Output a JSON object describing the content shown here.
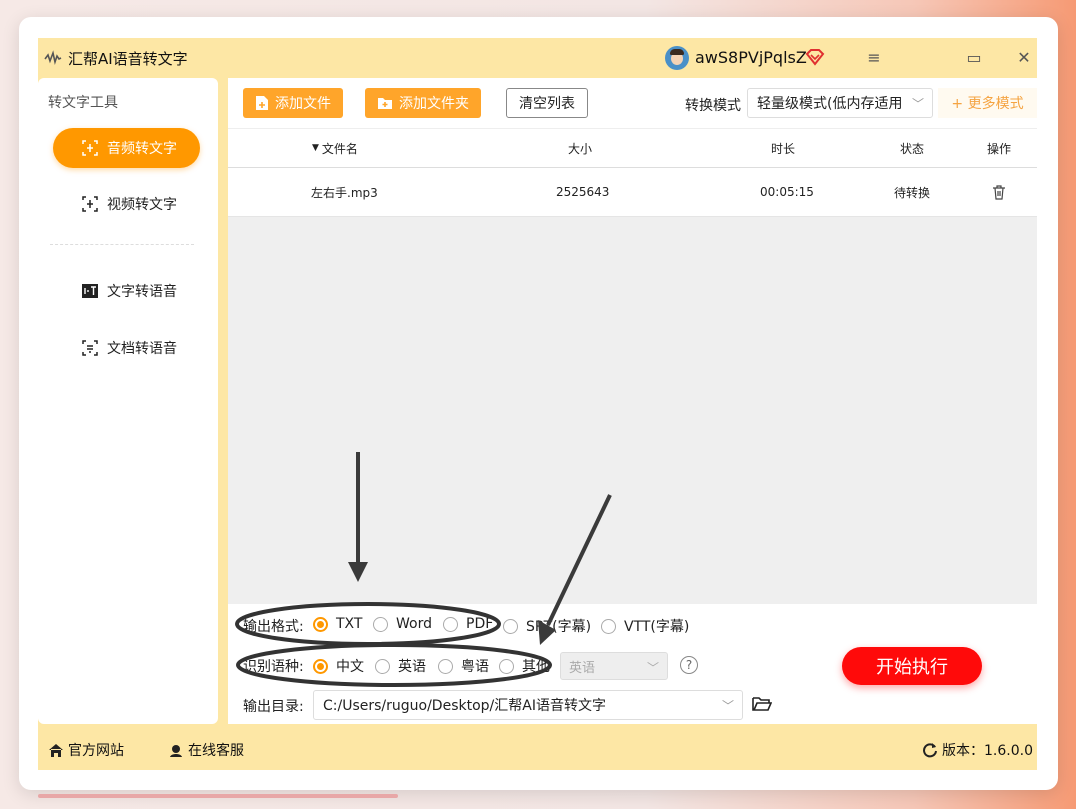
{
  "app": {
    "title": "汇帮AI语音转文字",
    "username": "awS8PVjPqlsZ"
  },
  "window_controls": {
    "menu": "≡",
    "maximize": "▭",
    "close": "✕"
  },
  "sidebar": {
    "title": "转文字工具",
    "items": [
      {
        "label": "音频转文字",
        "icon": "audio-to-text-icon",
        "active": true
      },
      {
        "label": "视频转文字",
        "icon": "video-to-text-icon",
        "active": false
      },
      {
        "label": "文字转语音",
        "icon": "text-to-speech-icon",
        "active": false
      },
      {
        "label": "文档转语音",
        "icon": "doc-to-speech-icon",
        "active": false
      }
    ]
  },
  "toolbar": {
    "add_file": "添加文件",
    "add_folder": "添加文件夹",
    "clear_list": "清空列表",
    "mode_label": "转换模式",
    "mode_value": "轻量级模式(低内存适用",
    "more_modes": "+ 更多模式"
  },
  "table": {
    "headers": {
      "name": "文件名",
      "size": "大小",
      "duration": "时长",
      "status": "状态",
      "action": "操作"
    },
    "rows": [
      {
        "name": "左右手.mp3",
        "size": "2525643",
        "duration": "00:05:15",
        "status": "待转换"
      }
    ]
  },
  "output": {
    "format_label": "输出格式:",
    "formats": [
      "TXT",
      "Word",
      "PDF",
      "SRT(字幕)",
      "VTT(字幕)"
    ],
    "selected_format": "TXT",
    "lang_label": "识别语种:",
    "languages": [
      "中文",
      "英语",
      "粤语",
      "其他"
    ],
    "selected_language": "中文",
    "other_lang_value": "英语",
    "help": "?",
    "dir_label": "输出目录:",
    "dir_value": "C:/Users/ruguo/Desktop/汇帮AI语音转文字",
    "start": "开始执行"
  },
  "footer": {
    "website": "官方网站",
    "support": "在线客服",
    "version": "版本：1.6.0.0"
  },
  "colors": {
    "accent": "#ff9800",
    "start_button": "#ff0a0a",
    "frame": "#fde7a5"
  }
}
